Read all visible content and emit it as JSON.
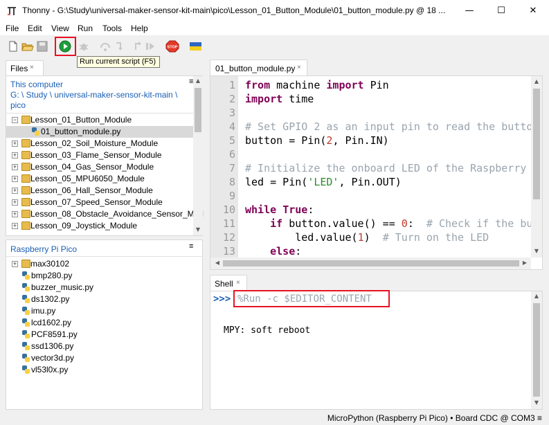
{
  "window": {
    "title": "Thonny  -  G:\\Study\\universal-maker-sensor-kit-main\\pico\\Lesson_01_Button_Module\\01_button_module.py  @  18 ...",
    "minimize_glyph": "—",
    "maximize_glyph": "☐",
    "close_glyph": "✕"
  },
  "menu": [
    "File",
    "Edit",
    "View",
    "Run",
    "Tools",
    "Help"
  ],
  "toolbar": {
    "tooltip": "Run current script (F5)",
    "icons": [
      "new-file-icon",
      "open-folder-icon",
      "save-icon",
      "run-icon",
      "debug-icon",
      "step-over-icon",
      "step-into-icon",
      "step-out-icon",
      "resume-icon",
      "stop-icon",
      "ukraine-flag-icon"
    ],
    "stop_label": "STOP"
  },
  "files_panel": {
    "tab": "Files",
    "tab_close": "×",
    "local": {
      "heading": "This computer",
      "path_line1": "G: \\ Study \\ universal-maker-sensor-kit-main \\",
      "path_line2": "pico",
      "items": [
        {
          "name": "Lesson_01_Button_Module",
          "type": "folder",
          "expanded": true
        },
        {
          "name": "01_button_module.py",
          "type": "py",
          "selected": true
        },
        {
          "name": "Lesson_02_Soil_Moisture_Module",
          "type": "folder"
        },
        {
          "name": "Lesson_03_Flame_Sensor_Module",
          "type": "folder"
        },
        {
          "name": "Lesson_04_Gas_Sensor_Module",
          "type": "folder"
        },
        {
          "name": "Lesson_05_MPU6050_Module",
          "type": "folder"
        },
        {
          "name": "Lesson_06_Hall_Sensor_Module",
          "type": "folder"
        },
        {
          "name": "Lesson_07_Speed_Sensor_Module",
          "type": "folder"
        },
        {
          "name": "Lesson_08_Obstacle_Avoidance_Sensor_Mod",
          "type": "folder"
        },
        {
          "name": "Lesson_09_Joystick_Module",
          "type": "folder"
        }
      ]
    },
    "device": {
      "heading": "Raspberry Pi Pico",
      "items": [
        {
          "name": "max30102",
          "type": "folder"
        },
        {
          "name": "bmp280.py",
          "type": "py"
        },
        {
          "name": "buzzer_music.py",
          "type": "py"
        },
        {
          "name": "ds1302.py",
          "type": "py"
        },
        {
          "name": "imu.py",
          "type": "py"
        },
        {
          "name": "lcd1602.py",
          "type": "py"
        },
        {
          "name": "PCF8591.py",
          "type": "py"
        },
        {
          "name": "ssd1306.py",
          "type": "py"
        },
        {
          "name": "vector3d.py",
          "type": "py"
        },
        {
          "name": "vl53l0x.py",
          "type": "py"
        }
      ]
    }
  },
  "editor": {
    "tab": "01_button_module.py",
    "tab_close": "×",
    "line_numbers": [
      "1",
      "2",
      "3",
      "4",
      "5",
      "6",
      "7",
      "8",
      "9",
      "10",
      "11",
      "12",
      "13"
    ],
    "lines": [
      [
        [
          "kw",
          "from"
        ],
        [
          "t",
          " machine "
        ],
        [
          "kw",
          "import"
        ],
        [
          "t",
          " Pin"
        ]
      ],
      [
        [
          "kw",
          "import"
        ],
        [
          "t",
          " time"
        ]
      ],
      [],
      [
        [
          "cm",
          "# Set GPIO 2 as an input pin to read the butto"
        ]
      ],
      [
        [
          "t",
          "button = Pin("
        ],
        [
          "num",
          "2"
        ],
        [
          "t",
          ", Pin.IN)"
        ]
      ],
      [],
      [
        [
          "cm",
          "# Initialize the onboard LED of the Raspberry"
        ]
      ],
      [
        [
          "t",
          "led = Pin("
        ],
        [
          "str",
          "'LED'"
        ],
        [
          "t",
          ", Pin.OUT)"
        ]
      ],
      [],
      [
        [
          "kw",
          "while"
        ],
        [
          "t",
          " "
        ],
        [
          "kw",
          "True"
        ],
        [
          "t",
          ":"
        ]
      ],
      [
        [
          "t",
          "    "
        ],
        [
          "kw",
          "if"
        ],
        [
          "t",
          " button.value() == "
        ],
        [
          "num",
          "0"
        ],
        [
          "t",
          ":  "
        ],
        [
          "cm",
          "# Check if the bu"
        ]
      ],
      [
        [
          "t",
          "        led.value("
        ],
        [
          "num",
          "1"
        ],
        [
          "t",
          ")  "
        ],
        [
          "cm",
          "# Turn on the LED"
        ]
      ],
      [
        [
          "t",
          "    "
        ],
        [
          "kw",
          "else"
        ],
        [
          "t",
          ":"
        ]
      ]
    ]
  },
  "shell": {
    "tab": "Shell",
    "tab_close": "×",
    "prompt": ">>>",
    "command": "%Run -c $EDITOR_CONTENT",
    "output": "MPY: soft reboot"
  },
  "status": {
    "text": "MicroPython (Raspberry Pi Pico)  •  Board CDC @ COM3  ≡"
  },
  "colors": {
    "accent_red": "#e81123",
    "link_blue": "#1a5fb4",
    "keyword": "#7f0055",
    "comment": "#9aa4ae",
    "run_green": "#1e9e3a"
  }
}
